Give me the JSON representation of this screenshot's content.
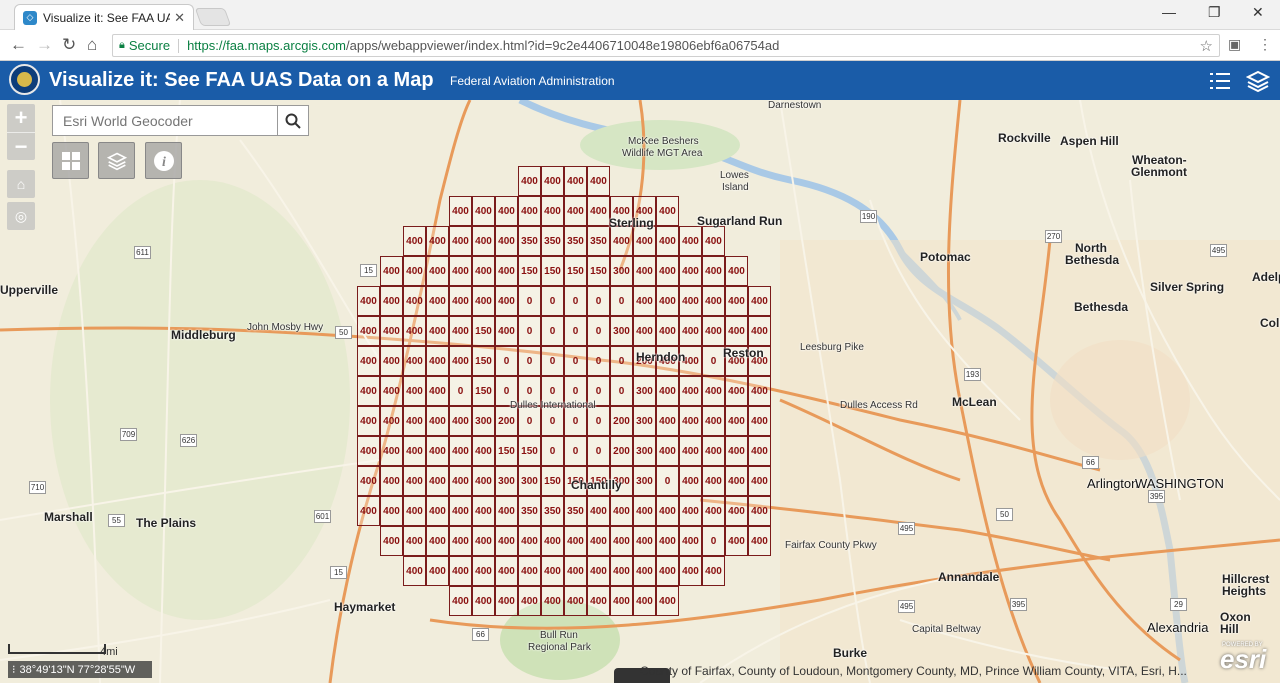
{
  "browser": {
    "tab_title": "Visualize it: See FAA UAS",
    "secure_label": "Secure",
    "url_host": "https://faa.maps.arcgis.com",
    "url_path": "/apps/webappviewer/index.html?id=9c2e4406710048e19806ebf6a06754ad"
  },
  "header": {
    "title": "Visualize it: See FAA UAS Data on a Map",
    "subtitle": "Federal Aviation Administration"
  },
  "search": {
    "placeholder": "Esri World Geocoder"
  },
  "map": {
    "coordinates": "38°49'13\"N 77°28'55\"W",
    "scale_label": "4mi",
    "attribution": "County of Fairfax, County of Loudoun, Montgomery County, MD, Prince William County, VITA, Esri, H...",
    "powered_by": "POWERED BY",
    "esri_logo": "esri",
    "grid_rows": [
      {
        "start": 23,
        "values": [
          "400",
          "400",
          "400",
          "400"
        ]
      },
      {
        "start": 20,
        "values": [
          "400",
          "400",
          "400",
          "400",
          "400",
          "400",
          "400",
          "400",
          "400",
          "400"
        ]
      },
      {
        "start": 18,
        "values": [
          "400",
          "400",
          "400",
          "400",
          "400",
          "350",
          "350",
          "350",
          "350",
          "400",
          "400",
          "400",
          "400",
          "400"
        ]
      },
      {
        "start": 17,
        "values": [
          "400",
          "400",
          "400",
          "400",
          "400",
          "400",
          "150",
          "150",
          "150",
          "150",
          "300",
          "400",
          "400",
          "400",
          "400",
          "400"
        ]
      },
      {
        "start": 16,
        "values": [
          "400",
          "400",
          "400",
          "400",
          "400",
          "400",
          "400",
          "0",
          "0",
          "0",
          "0",
          "0",
          "400",
          "400",
          "400",
          "400",
          "400",
          "400"
        ]
      },
      {
        "start": 16,
        "values": [
          "400",
          "400",
          "400",
          "400",
          "400",
          "150",
          "400",
          "0",
          "0",
          "0",
          "0",
          "300",
          "400",
          "400",
          "400",
          "400",
          "400",
          "400"
        ]
      },
      {
        "start": 16,
        "values": [
          "400",
          "400",
          "400",
          "400",
          "400",
          "150",
          "0",
          "0",
          "0",
          "0",
          "0",
          "0",
          "200",
          "400",
          "400",
          "0",
          "400",
          "400"
        ]
      },
      {
        "start": 16,
        "values": [
          "400",
          "400",
          "400",
          "400",
          "0",
          "150",
          "0",
          "0",
          "0",
          "0",
          "0",
          "0",
          "300",
          "400",
          "400",
          "400",
          "400",
          "400"
        ]
      },
      {
        "start": 16,
        "values": [
          "400",
          "400",
          "400",
          "400",
          "400",
          "300",
          "200",
          "0",
          "0",
          "0",
          "0",
          "200",
          "300",
          "400",
          "400",
          "400",
          "400",
          "400"
        ]
      },
      {
        "start": 16,
        "values": [
          "400",
          "400",
          "400",
          "400",
          "400",
          "400",
          "150",
          "150",
          "0",
          "0",
          "0",
          "200",
          "300",
          "400",
          "400",
          "400",
          "400",
          "400"
        ]
      },
      {
        "start": 16,
        "values": [
          "400",
          "400",
          "400",
          "400",
          "400",
          "400",
          "300",
          "300",
          "150",
          "150",
          "150",
          "300",
          "300",
          "0",
          "400",
          "400",
          "400",
          "400"
        ]
      },
      {
        "start": 16,
        "values": [
          "400",
          "400",
          "400",
          "400",
          "400",
          "400",
          "400",
          "350",
          "350",
          "350",
          "400",
          "400",
          "400",
          "400",
          "400",
          "400",
          "400",
          "400"
        ]
      },
      {
        "start": 17,
        "values": [
          "400",
          "400",
          "400",
          "400",
          "400",
          "400",
          "400",
          "400",
          "400",
          "400",
          "400",
          "400",
          "400",
          "400",
          "0",
          "400",
          "400"
        ]
      },
      {
        "start": 18,
        "values": [
          "400",
          "400",
          "400",
          "400",
          "400",
          "400",
          "400",
          "400",
          "400",
          "400",
          "400",
          "400",
          "400",
          "400"
        ]
      },
      {
        "start": 20,
        "values": [
          "400",
          "400",
          "400",
          "400",
          "400",
          "400",
          "400",
          "400",
          "400",
          "400"
        ]
      }
    ],
    "labels": [
      {
        "text": "Darnestown",
        "cls": ""
      },
      {
        "text": "Rockville",
        "cls": "big"
      },
      {
        "text": "Aspen Hill",
        "cls": "big"
      },
      {
        "text": "Wheaton-",
        "cls": "big"
      },
      {
        "text": "Glenmont",
        "cls": "big"
      },
      {
        "text": "North",
        "cls": "big"
      },
      {
        "text": "Bethesda",
        "cls": "big"
      },
      {
        "text": "Silver Spring",
        "cls": "big"
      },
      {
        "text": "Bethesda",
        "cls": "big"
      },
      {
        "text": "Adelp",
        "cls": "big"
      },
      {
        "text": "Coll",
        "cls": "big"
      },
      {
        "text": "Potomac",
        "cls": "big"
      },
      {
        "text": "McLean",
        "cls": "big"
      },
      {
        "text": "Sugarland Run",
        "cls": "big"
      },
      {
        "text": "Sterling",
        "cls": "big"
      },
      {
        "text": "Herndon",
        "cls": "big"
      },
      {
        "text": "Reston",
        "cls": "big"
      },
      {
        "text": "Chantilly",
        "cls": "big"
      },
      {
        "text": "Arlington",
        "cls": "city"
      },
      {
        "text": "WASHINGTON",
        "cls": "city"
      },
      {
        "text": "Alexandria",
        "cls": "city"
      },
      {
        "text": "Annandale",
        "cls": "big"
      },
      {
        "text": "Burke",
        "cls": "big"
      },
      {
        "text": "Hillcrest",
        "cls": "big"
      },
      {
        "text": "Heights",
        "cls": "big"
      },
      {
        "text": "Oxon",
        "cls": "big"
      },
      {
        "text": "Hill",
        "cls": "big"
      },
      {
        "text": "Upperville",
        "cls": "big"
      },
      {
        "text": "Middleburg",
        "cls": "big"
      },
      {
        "text": "Marshall",
        "cls": "big"
      },
      {
        "text": "The Plains",
        "cls": "big"
      },
      {
        "text": "Haymarket",
        "cls": "big"
      },
      {
        "text": "McKee Beshers",
        "cls": ""
      },
      {
        "text": "Wildlife MGT Area",
        "cls": ""
      },
      {
        "text": "Lowes",
        "cls": ""
      },
      {
        "text": "Island",
        "cls": ""
      },
      {
        "text": "Bull Run",
        "cls": ""
      },
      {
        "text": "Regional Park",
        "cls": ""
      },
      {
        "text": "Dulles International",
        "cls": ""
      },
      {
        "text": "John Mosby Hwy",
        "cls": ""
      },
      {
        "text": "Dulles Access Rd",
        "cls": ""
      },
      {
        "text": "Leesburg Pike",
        "cls": ""
      },
      {
        "text": "Capital Beltway",
        "cls": ""
      },
      {
        "text": "Fairfax County Pkwy",
        "cls": ""
      }
    ],
    "shields": [
      "611",
      "15",
      "50",
      "709",
      "626",
      "710",
      "55",
      "601",
      "15",
      "190",
      "270",
      "495",
      "193",
      "66",
      "395",
      "50",
      "495",
      "395",
      "495",
      "66",
      "29"
    ]
  },
  "colors": {
    "header_bg": "#1a5ca8",
    "grid_border": "#7a1c1c",
    "grid_text": "#8a1010",
    "map_bg": "#f1eddc"
  }
}
